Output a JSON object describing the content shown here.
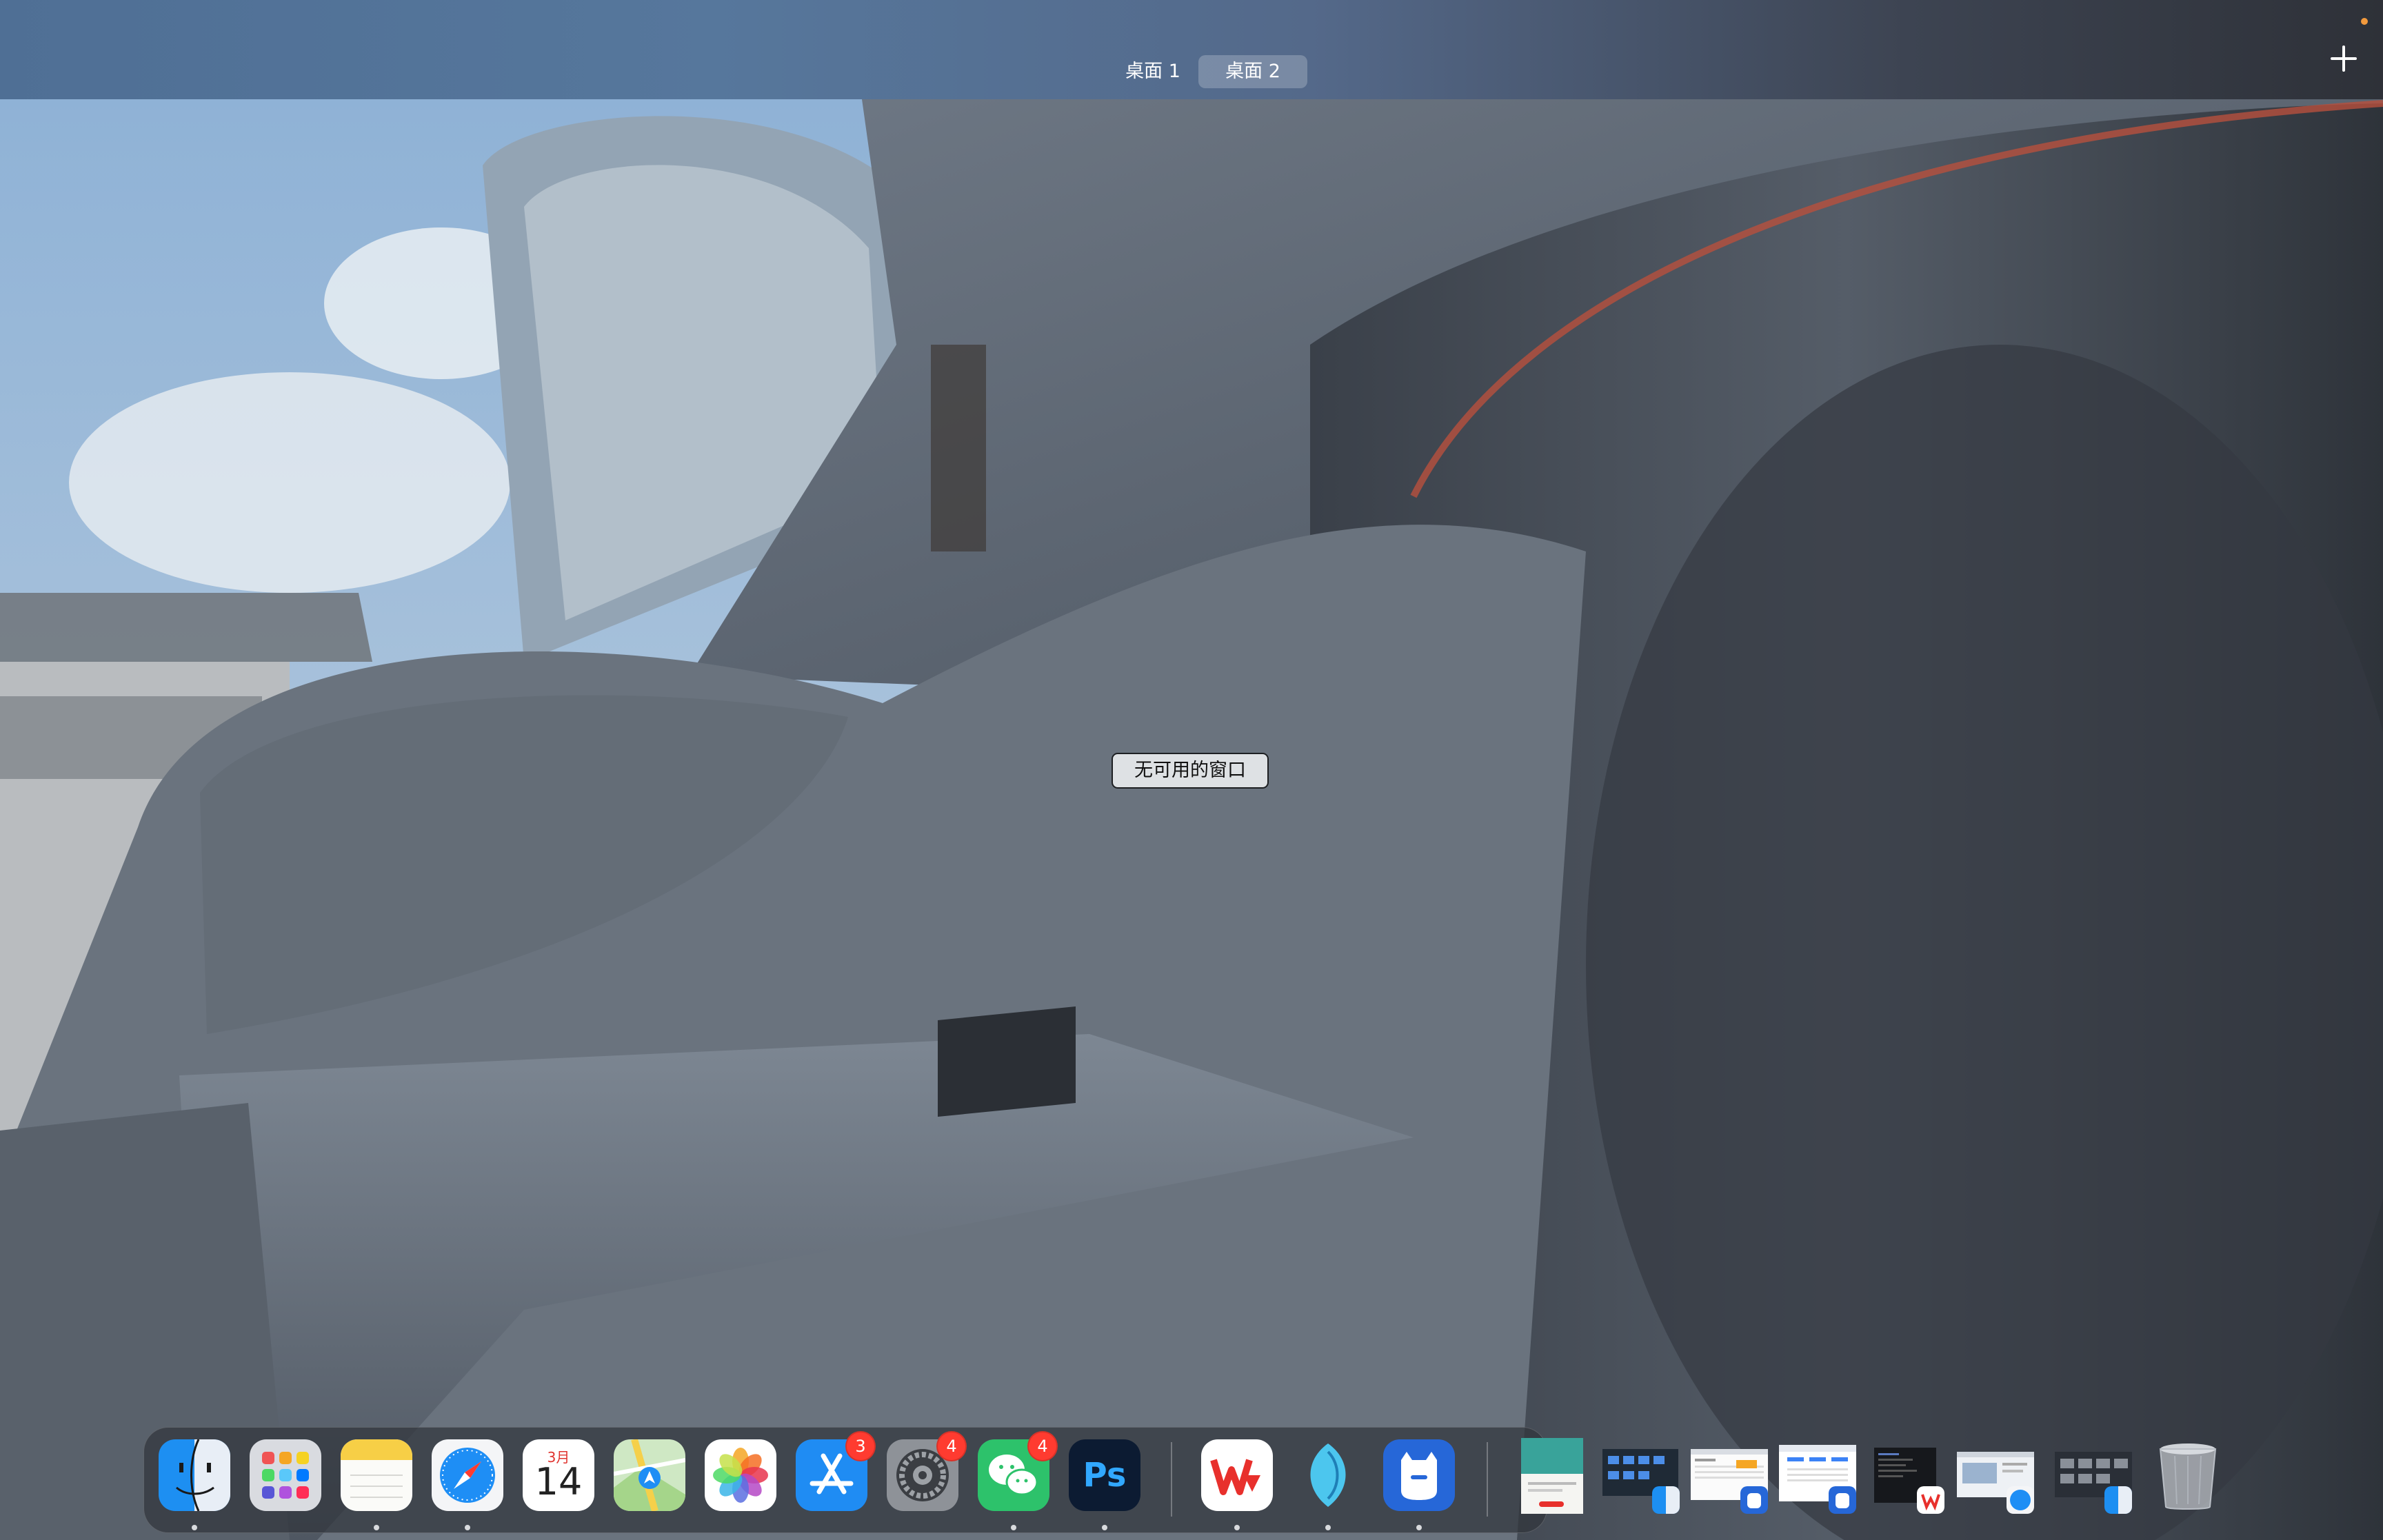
{
  "mission_control": {
    "spaces": [
      {
        "label": "桌面 1",
        "active": false
      },
      {
        "label": "桌面 2",
        "active": true
      }
    ],
    "add_space_icon": "plus-icon",
    "no_windows_label": "无可用的窗口"
  },
  "dock": {
    "apps": [
      {
        "name": "Finder",
        "icon": "finder-icon",
        "running": true
      },
      {
        "name": "Launchpad",
        "icon": "launchpad-icon",
        "running": false
      },
      {
        "name": "Notes",
        "icon": "notes-icon",
        "running": true
      },
      {
        "name": "Safari",
        "icon": "safari-icon",
        "running": true
      },
      {
        "name": "Calendar",
        "icon": "calendar-icon",
        "running": false,
        "month": "3月",
        "day": "14"
      },
      {
        "name": "Maps",
        "icon": "maps-icon",
        "running": false
      },
      {
        "name": "Photos",
        "icon": "photos-icon",
        "running": false
      },
      {
        "name": "App Store",
        "icon": "app-store-icon",
        "running": false,
        "badge": "3"
      },
      {
        "name": "System Settings",
        "icon": "settings-icon",
        "running": false,
        "badge": "4"
      },
      {
        "name": "WeChat",
        "icon": "wechat-icon",
        "running": true,
        "badge": "4"
      },
      {
        "name": "Photoshop",
        "icon": "photoshop-icon",
        "running": true,
        "label": "Ps"
      },
      {
        "name": "WPS Office",
        "icon": "wps-icon",
        "running": true
      },
      {
        "name": "Mail Master",
        "icon": "feather-icon",
        "running": true
      },
      {
        "name": "Clash",
        "icon": "cat-icon",
        "running": true
      }
    ],
    "minimized_windows": [
      {
        "icon": "document-thumbnail",
        "app": "none"
      },
      {
        "icon": "finder-window-thumbnail",
        "app": "finder-icon"
      },
      {
        "icon": "spreadsheet-window-thumbnail",
        "app": "cat-icon"
      },
      {
        "icon": "dashboard-window-thumbnail",
        "app": "cat-icon"
      },
      {
        "icon": "dark-editor-thumbnail",
        "app": "wps-icon"
      },
      {
        "icon": "browser-window-thumbnail",
        "app": "safari-icon"
      },
      {
        "icon": "finder-grid-thumbnail",
        "app": "finder-icon"
      }
    ],
    "trash_icon": "trash-icon"
  },
  "colors": {
    "accent": "#f29a3d",
    "badge": "#ff3b30"
  }
}
